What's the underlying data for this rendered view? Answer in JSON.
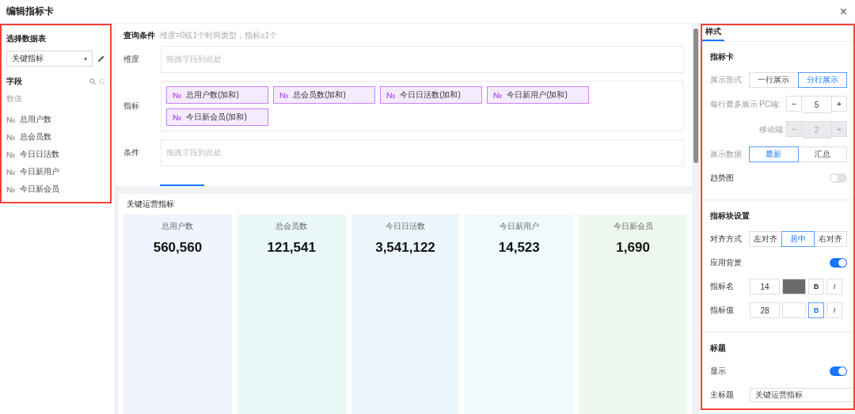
{
  "window": {
    "title": "编辑指标卡",
    "close": "×"
  },
  "left": {
    "highlighted": true,
    "heading": "选择数据表",
    "select": {
      "value": "关键指标",
      "caret": "▾"
    },
    "fields_heading": "字段",
    "group": "数值",
    "fields": [
      {
        "icon": "№",
        "name": "总用户数"
      },
      {
        "icon": "№",
        "name": "总会员数"
      },
      {
        "icon": "№",
        "name": "今日日活数"
      },
      {
        "icon": "№",
        "name": "今日新用户"
      },
      {
        "icon": "№",
        "name": "今日新会员"
      }
    ]
  },
  "query": {
    "title": "查询条件",
    "hint": "维度=0或1个时间类型，指标≥1个",
    "rows": [
      {
        "kind": "drop",
        "label": "维度",
        "placeholder": "拖拽字段到此处"
      },
      {
        "kind": "chips",
        "label": "指标",
        "chips": [
          {
            "icon": "№",
            "text": "总用户数(加和)"
          },
          {
            "icon": "№",
            "text": "总会员数(加和)"
          },
          {
            "icon": "№",
            "text": "今日日活数(加和)"
          },
          {
            "icon": "№",
            "text": "今日新用户(加和)"
          },
          {
            "icon": "№",
            "text": "今日新会员(加和)"
          }
        ]
      },
      {
        "kind": "drop",
        "label": "条件",
        "placeholder": "拖拽字段到此处"
      }
    ]
  },
  "preview": {
    "title": "关键运营指标",
    "metrics": [
      {
        "name": "总用户数",
        "value": "560,560",
        "color": "#f0f4fe"
      },
      {
        "name": "总会员数",
        "value": "121,541",
        "color": "#eaf7f7"
      },
      {
        "name": "今日日活数",
        "value": "3,541,122",
        "color": "#ecf6fd"
      },
      {
        "name": "今日新用户",
        "value": "14,523",
        "color": "#eefafb"
      },
      {
        "name": "今日新会员",
        "value": "1,690",
        "color": "#eff8f0"
      }
    ]
  },
  "style": {
    "highlighted": true,
    "tabs": [
      {
        "label": "样式",
        "selected": true
      }
    ],
    "sections": [
      {
        "title": "指标卡",
        "rows": [
          {
            "kind": "segmented",
            "label": "展示形式",
            "options": [
              {
                "label": "一行展示",
                "selected": false
              },
              {
                "label": "分行展示",
                "selected": true
              }
            ]
          },
          {
            "kind": "stepper",
            "label": "每行最多展示",
            "sublabel": "PC端:",
            "minus": "−",
            "value": "5",
            "plus": "+",
            "disabled": false
          },
          {
            "kind": "stepper",
            "sublabel": "移动端:",
            "minus": "−",
            "value": "2",
            "plus": "+",
            "disabled": true
          },
          {
            "kind": "segmented",
            "label": "展示数据",
            "options": [
              {
                "label": "最新",
                "selected": true
              },
              {
                "label": "汇总",
                "selected": false
              }
            ]
          },
          {
            "kind": "toggle",
            "label": "趋势图",
            "on": false
          }
        ]
      },
      {
        "title": "指标块设置",
        "rows": [
          {
            "kind": "segmented",
            "label": "对齐方式",
            "options": [
              {
                "label": "左对齐",
                "selected": false
              },
              {
                "label": "居中",
                "selected": true
              },
              {
                "label": "右对齐",
                "selected": false
              }
            ]
          },
          {
            "kind": "toggle",
            "label": "应用背景",
            "on": true
          },
          {
            "kind": "font",
            "label": "指标名",
            "size": "14",
            "color": "#6b6b6b",
            "bold_label": "B",
            "bold": false,
            "italic_label": "I",
            "italic": false
          },
          {
            "kind": "font",
            "label": "指标值",
            "size": "28",
            "color": "#ffffff",
            "bold_label": "B",
            "bold": true,
            "italic_label": "I",
            "italic": false
          }
        ]
      },
      {
        "title": "标题",
        "rows": [
          {
            "kind": "toggle",
            "label": "显示",
            "on": true
          },
          {
            "kind": "text",
            "label": "主标题",
            "value": "关键运营指标"
          }
        ]
      }
    ]
  }
}
